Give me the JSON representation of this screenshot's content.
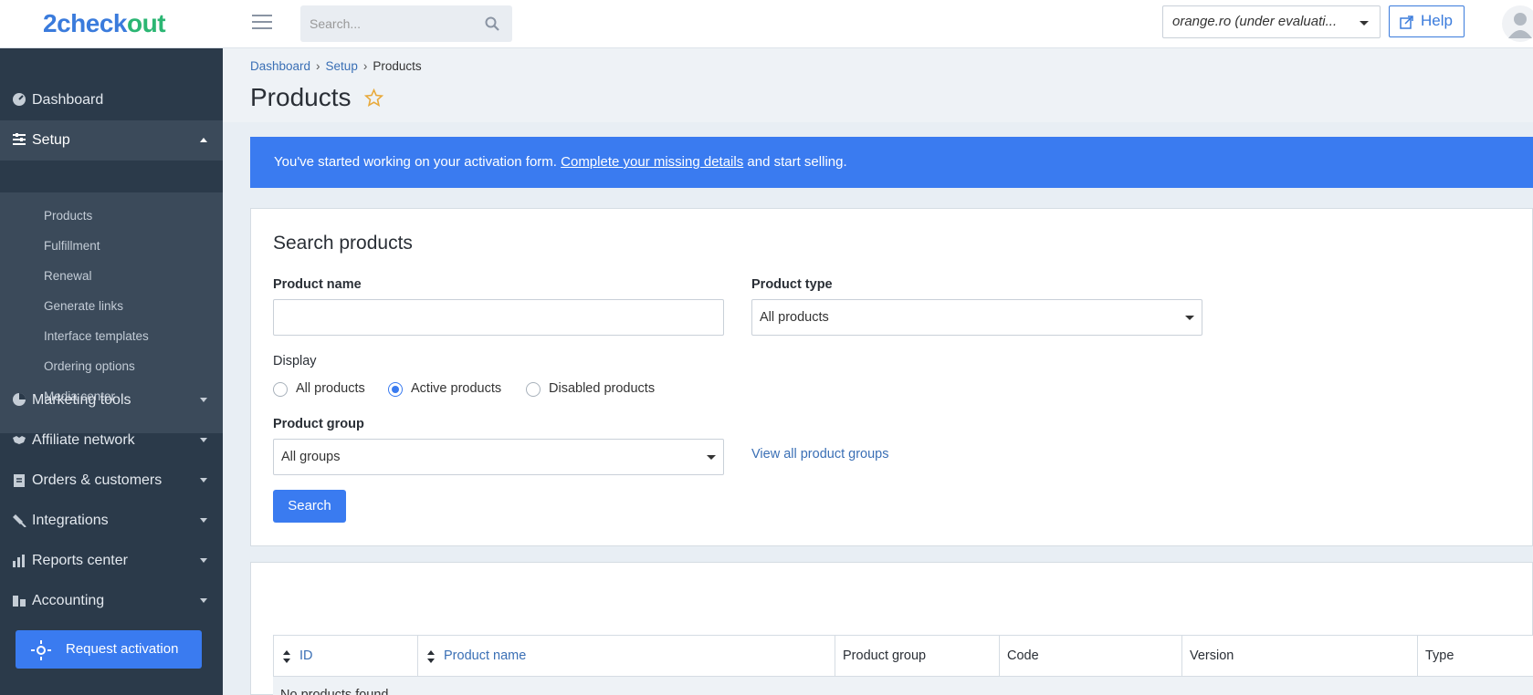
{
  "brand": {
    "logo_part1": "2",
    "logo_part2": "check",
    "logo_part3": "out"
  },
  "topbar": {
    "search_placeholder": "Search...",
    "account": "orange.ro (under evaluati...",
    "help_label": "Help"
  },
  "sidebar": {
    "items": [
      {
        "label": "Dashboard",
        "icon": "dashboard-icon"
      },
      {
        "label": "Setup",
        "icon": "sliders-icon",
        "expanded": true
      },
      {
        "label": "Marketing tools",
        "icon": "pie-chart-icon"
      },
      {
        "label": "Affiliate network",
        "icon": "handshake-icon"
      },
      {
        "label": "Orders & customers",
        "icon": "clipboard-icon"
      },
      {
        "label": "Integrations",
        "icon": "plug-icon"
      },
      {
        "label": "Reports center",
        "icon": "bar-chart-icon"
      },
      {
        "label": "Accounting",
        "icon": "coins-icon"
      }
    ],
    "setup_sub": [
      "Products",
      "Fulfillment",
      "Renewal",
      "Generate links",
      "Interface templates",
      "Ordering options",
      "Media center"
    ],
    "activation_label": "Request activation"
  },
  "breadcrumb": {
    "items": [
      "Dashboard",
      "Setup"
    ],
    "current": "Products"
  },
  "page_title": "Products",
  "banner": {
    "before": "You've started working on your activation form. ",
    "link": "Complete your missing details",
    "after": " and start selling."
  },
  "search": {
    "heading": "Search products",
    "product_name_label": "Product name",
    "product_name_value": "",
    "product_type_label": "Product type",
    "product_type_value": "All products",
    "display_label": "Display",
    "display_options": [
      "All products",
      "Active products",
      "Disabled products"
    ],
    "display_selected": "Active products",
    "product_group_label": "Product group",
    "product_group_value": "All groups",
    "view_groups_link": "View all product groups",
    "search_button": "Search"
  },
  "table": {
    "columns": [
      "ID",
      "Product name",
      "Product group",
      "Code",
      "Version",
      "Type"
    ],
    "empty_text": "No products found"
  },
  "colors": {
    "accent": "#3a7bf0",
    "sidebar": "#2b3a4a",
    "logo_blue": "#3a7bdc",
    "logo_green": "#2bb673"
  }
}
